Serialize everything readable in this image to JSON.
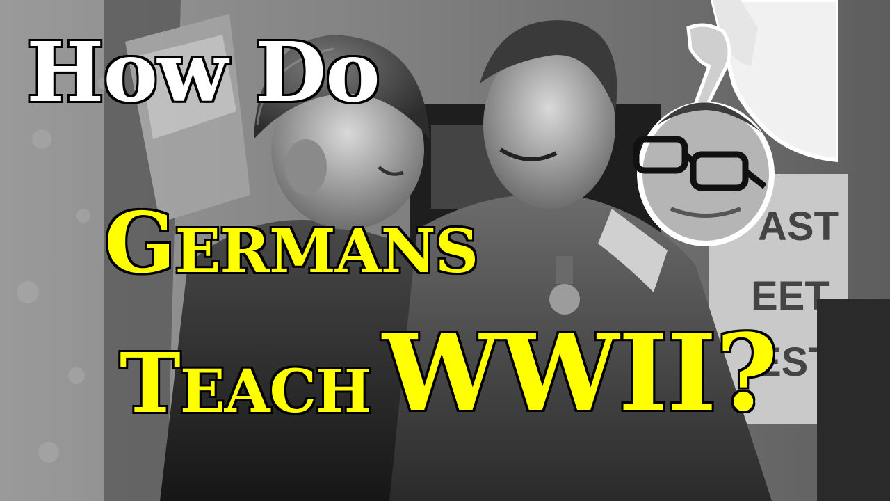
{
  "thumbnail": {
    "title_line_1": "How Do",
    "title_line_2_initial": "G",
    "title_line_2_rest": "ERMANS",
    "title_line_3_initial": "T",
    "title_line_3_rest": "EACH",
    "title_line_3_emphasis": "WWII?",
    "poster_letters": [
      "AST",
      "EET",
      "EST"
    ]
  },
  "colors": {
    "title_primary": "#ffffff",
    "title_accent": "#ffff00",
    "outline": "#000000"
  }
}
